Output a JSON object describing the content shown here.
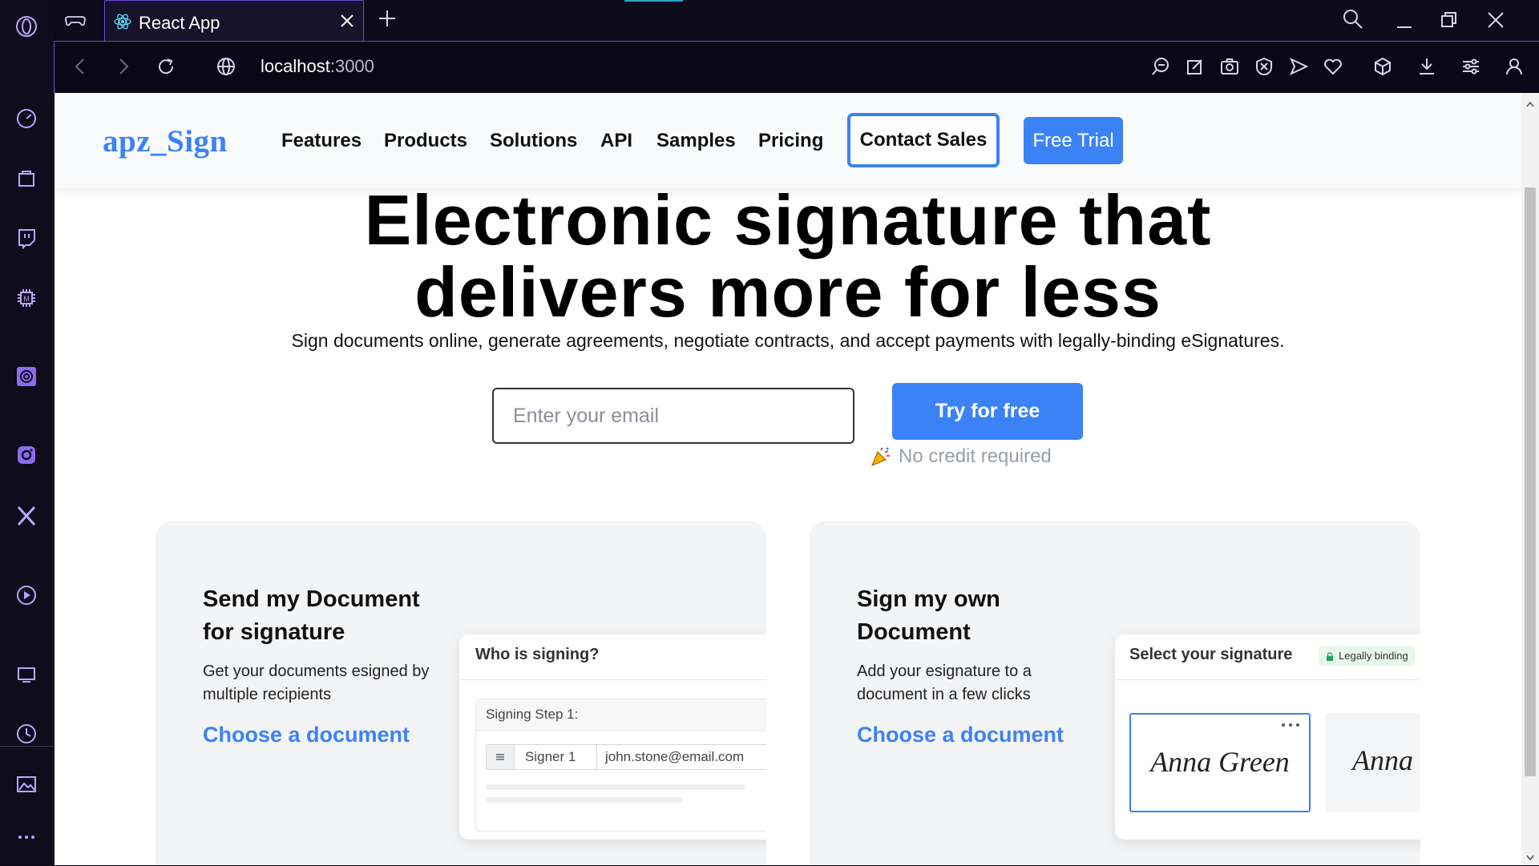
{
  "browser": {
    "tab_title": "React App",
    "url_host": "localhost",
    "url_port": ":3000",
    "accent": "#6d4cd6"
  },
  "nav": {
    "logo": "apz_Sign",
    "links": [
      "Features",
      "Products",
      "Solutions",
      "API",
      "Samples",
      "Pricing"
    ],
    "contact_label": "Contact Sales",
    "trial_label": "Free Trial"
  },
  "hero": {
    "title_line1": "Electronic signature that",
    "title_line2": "delivers more for less",
    "subtitle": "Sign documents online, generate agreements, negotiate contracts, and accept payments with legally-binding eSignatures.",
    "email_placeholder": "Enter your email",
    "cta_label": "Try for free",
    "note": "No credit required"
  },
  "cards": [
    {
      "title_line1": "Send my Document",
      "title_line2": "for signature",
      "desc_line1": "Get your documents esigned by",
      "desc_line2": "multiple recipients",
      "link": "Choose a document",
      "mock": {
        "heading": "Who is signing?",
        "step_label": "Signing Step 1:",
        "signer_label": "Signer 1",
        "signer_email": "john.stone@email.com"
      }
    },
    {
      "title_line1": "Sign my own",
      "title_line2": "Document",
      "desc_line1": "Add your esignature to a",
      "desc_line2": "document in a few clicks",
      "link": "Choose a document",
      "mock": {
        "heading": "Select your signature",
        "badge": "Legally binding",
        "signature1": "Anna Green",
        "signature2": "Anna Green"
      }
    }
  ],
  "colors": {
    "brand_blue": "#3b82f6",
    "sidebar_icon": "#b9a6ff"
  }
}
